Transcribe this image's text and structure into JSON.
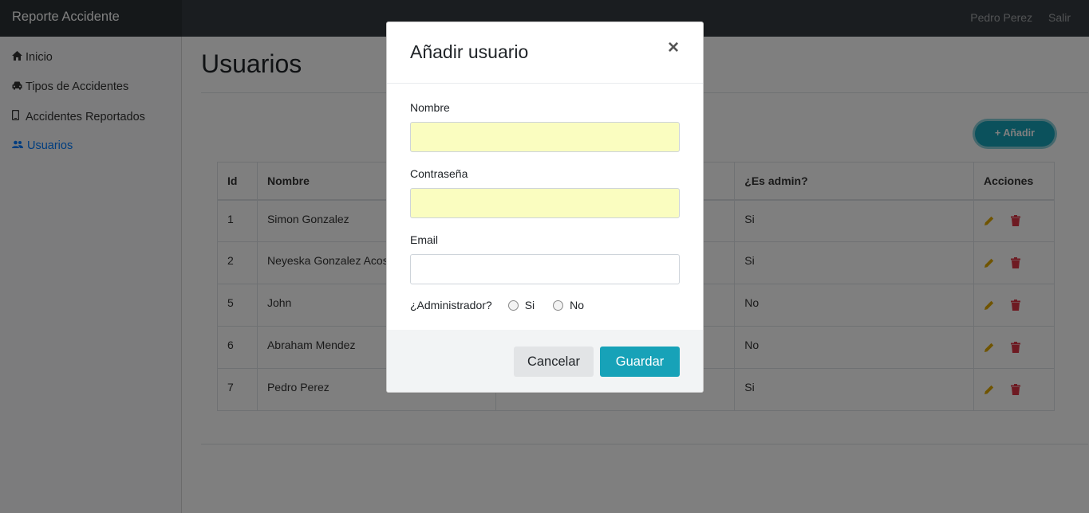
{
  "navbar": {
    "brand": "Reporte Accidente",
    "user": "Pedro Perez",
    "logout": "Salir"
  },
  "sidebar": {
    "items": [
      {
        "label": "Inicio",
        "icon": "home-icon"
      },
      {
        "label": "Tipos de Accidentes",
        "icon": "car-icon"
      },
      {
        "label": "Accidentes Reportados",
        "icon": "mobile-icon"
      },
      {
        "label": "Usuarios",
        "icon": "users-icon",
        "active": true
      }
    ]
  },
  "main": {
    "title": "Usuarios",
    "add_label": "+ Añadir",
    "table": {
      "headers": [
        "Id",
        "Nombre",
        "",
        "¿Es admin?",
        "Acciones"
      ],
      "rows": [
        {
          "id": "1",
          "nombre": "Simon Gonzalez",
          "admin": "Si"
        },
        {
          "id": "2",
          "nombre": "Neyeska Gonzalez Acos",
          "admin": "Si"
        },
        {
          "id": "5",
          "nombre": "John",
          "admin": "No"
        },
        {
          "id": "6",
          "nombre": "Abraham Mendez",
          "admin": "No"
        },
        {
          "id": "7",
          "nombre": "Pedro Perez",
          "admin": "Si"
        }
      ]
    }
  },
  "modal": {
    "title": "Añadir usuario",
    "close": "×",
    "fields": {
      "nombre_label": "Nombre",
      "nombre_value": "",
      "password_label": "Contraseña",
      "password_value": "",
      "email_label": "Email",
      "email_value": ""
    },
    "admin_label": "¿Administrador?",
    "admin_yes": "Si",
    "admin_no": "No",
    "cancel_label": "Cancelar",
    "save_label": "Guardar"
  },
  "colors": {
    "accent": "#17a2b8",
    "active_link": "#007bff",
    "edit": "#e0a800",
    "delete": "#dc3545"
  }
}
